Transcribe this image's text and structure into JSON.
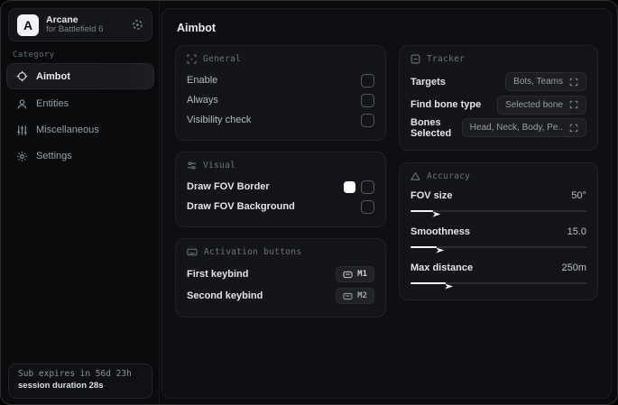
{
  "sidebar": {
    "brand": {
      "initial": "A",
      "name": "Arcane",
      "subtitle": "for Battlefield 6"
    },
    "category_label": "Category",
    "items": [
      {
        "label": "Aimbot",
        "icon": "crosshair-icon",
        "active": true
      },
      {
        "label": "Entities",
        "icon": "entities-icon",
        "active": false
      },
      {
        "label": "Miscellaneous",
        "icon": "sliders-vertical-icon",
        "active": false
      },
      {
        "label": "Settings",
        "icon": "gear-icon",
        "active": false
      }
    ],
    "footer": {
      "line1": "Sub expires in 56d 23h",
      "line2": "session duration 28s"
    }
  },
  "main": {
    "title": "Aimbot",
    "general": {
      "title": "General",
      "icon": "scan-icon",
      "rows": [
        {
          "label": "Enable",
          "checked": false
        },
        {
          "label": "Always",
          "checked": false
        },
        {
          "label": "Visibility check",
          "checked": false
        }
      ]
    },
    "visual": {
      "title": "Visual",
      "icon": "sliders-horizontal-icon",
      "rows": [
        {
          "label": "Draw FOV Border",
          "swatch_color": "#ffffff",
          "checked": false
        },
        {
          "label": "Draw FOV Background",
          "checked": false
        }
      ]
    },
    "activation": {
      "title": "Activation buttons",
      "icon": "keyboard-icon",
      "rows": [
        {
          "label": "First keybind",
          "key": "M1"
        },
        {
          "label": "Second keybind",
          "key": "M2"
        }
      ]
    },
    "tracker": {
      "title": "Tracker",
      "icon": "box-minus-icon",
      "rows": [
        {
          "label": "Targets",
          "value": "Bots, Teams"
        },
        {
          "label": "Find bone type",
          "value": "Selected bone"
        },
        {
          "label": "Bones Selected",
          "value": "Head, Neck, Body, Pe.."
        }
      ]
    },
    "accuracy": {
      "title": "Accuracy",
      "icon": "triangle-icon",
      "rows": [
        {
          "label": "FOV size",
          "value": "50°",
          "fill_pct": 13
        },
        {
          "label": "Smoothness",
          "value": "15.0",
          "fill_pct": 15
        },
        {
          "label": "Max distance",
          "value": "250m",
          "fill_pct": 20
        }
      ]
    }
  }
}
